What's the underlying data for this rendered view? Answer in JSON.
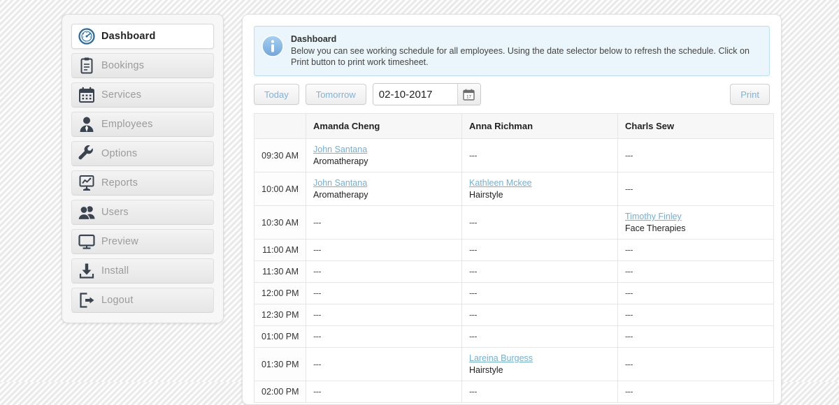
{
  "sidebar": {
    "items": [
      {
        "label": "Dashboard",
        "icon": "gauge-icon",
        "key": "dashboard",
        "active": true
      },
      {
        "label": "Bookings",
        "icon": "clipboard-icon",
        "key": "bookings",
        "active": false
      },
      {
        "label": "Services",
        "icon": "calendar-icon",
        "key": "services",
        "active": false
      },
      {
        "label": "Employees",
        "icon": "person-tie-icon",
        "key": "employees",
        "active": false
      },
      {
        "label": "Options",
        "icon": "wrench-icon",
        "key": "options",
        "active": false
      },
      {
        "label": "Reports",
        "icon": "chart-board-icon",
        "key": "reports",
        "active": false
      },
      {
        "label": "Users",
        "icon": "users-icon",
        "key": "users",
        "active": false
      },
      {
        "label": "Preview",
        "icon": "monitor-icon",
        "key": "preview",
        "active": false
      },
      {
        "label": "Install",
        "icon": "download-icon",
        "key": "install",
        "active": false
      },
      {
        "label": "Logout",
        "icon": "logout-icon",
        "key": "logout",
        "active": false
      }
    ]
  },
  "banner": {
    "icon": "info-icon",
    "title": "Dashboard",
    "body": "Below you can see working schedule for all employees. Using the date selector below to refresh the schedule. Click on Print button to print work timesheet.",
    "background_color": "#eaf6fb",
    "border_color": "#b9dff0"
  },
  "toolbar": {
    "today_label": "Today",
    "tomorrow_label": "Tomorrow",
    "date_value": "02-10-2017",
    "date_placeholder": "mm-dd-yyyy",
    "date_picker_icon": "calendar-icon",
    "date_picker_day": "17",
    "print_label": "Print",
    "button_text_color": "#7ab4dd"
  },
  "table": {
    "headers": [
      "",
      "Amanda Cheng",
      "Anna Richman",
      "Charls Sew"
    ],
    "empty_marker": "---",
    "rows": [
      {
        "time": "09:30 AM",
        "cells": [
          {
            "empty": false,
            "client": "John Santana",
            "service": "Aromatherapy"
          },
          {
            "empty": true,
            "client": "",
            "service": ""
          },
          {
            "empty": true,
            "client": "",
            "service": ""
          }
        ]
      },
      {
        "time": "10:00 AM",
        "cells": [
          {
            "empty": false,
            "client": "John Santana",
            "service": "Aromatherapy"
          },
          {
            "empty": false,
            "client": "Kathleen Mckee",
            "service": "Hairstyle"
          },
          {
            "empty": true,
            "client": "",
            "service": ""
          }
        ]
      },
      {
        "time": "10:30 AM",
        "cells": [
          {
            "empty": true,
            "client": "",
            "service": ""
          },
          {
            "empty": true,
            "client": "",
            "service": ""
          },
          {
            "empty": false,
            "client": "Timothy Finley",
            "service": "Face Therapies"
          }
        ]
      },
      {
        "time": "11:00 AM",
        "cells": [
          {
            "empty": true,
            "client": "",
            "service": ""
          },
          {
            "empty": true,
            "client": "",
            "service": ""
          },
          {
            "empty": true,
            "client": "",
            "service": ""
          }
        ]
      },
      {
        "time": "11:30 AM",
        "cells": [
          {
            "empty": true,
            "client": "",
            "service": ""
          },
          {
            "empty": true,
            "client": "",
            "service": ""
          },
          {
            "empty": true,
            "client": "",
            "service": ""
          }
        ]
      },
      {
        "time": "12:00 PM",
        "cells": [
          {
            "empty": true,
            "client": "",
            "service": ""
          },
          {
            "empty": true,
            "client": "",
            "service": ""
          },
          {
            "empty": true,
            "client": "",
            "service": ""
          }
        ]
      },
      {
        "time": "12:30 PM",
        "cells": [
          {
            "empty": true,
            "client": "",
            "service": ""
          },
          {
            "empty": true,
            "client": "",
            "service": ""
          },
          {
            "empty": true,
            "client": "",
            "service": ""
          }
        ]
      },
      {
        "time": "01:00 PM",
        "cells": [
          {
            "empty": true,
            "client": "",
            "service": ""
          },
          {
            "empty": true,
            "client": "",
            "service": ""
          },
          {
            "empty": true,
            "client": "",
            "service": ""
          }
        ]
      },
      {
        "time": "01:30 PM",
        "cells": [
          {
            "empty": true,
            "client": "",
            "service": ""
          },
          {
            "empty": false,
            "client": "Lareina Burgess",
            "service": "Hairstyle"
          },
          {
            "empty": true,
            "client": "",
            "service": ""
          }
        ]
      },
      {
        "time": "02:00 PM",
        "cells": [
          {
            "empty": true,
            "client": "",
            "service": ""
          },
          {
            "empty": true,
            "client": "",
            "service": ""
          },
          {
            "empty": true,
            "client": "",
            "service": ""
          }
        ]
      }
    ]
  },
  "colors": {
    "link": "#70b0da",
    "accent": "#7ab4dd",
    "sidebar_label": "#9b9b9b",
    "text": "#333333"
  }
}
